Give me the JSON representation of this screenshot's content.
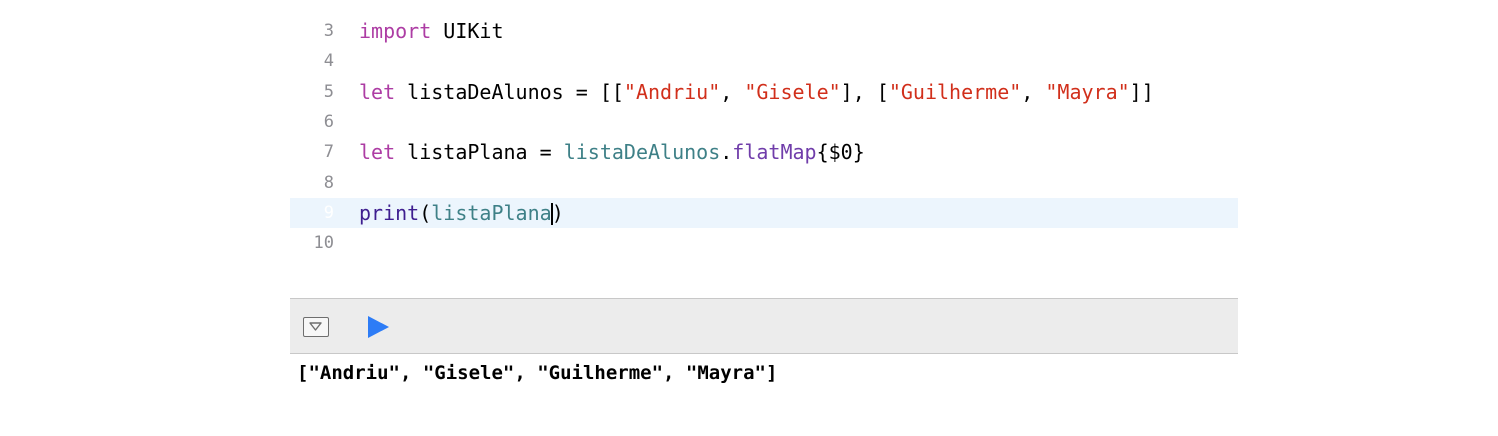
{
  "editor": {
    "lines": [
      {
        "number": "3",
        "tokens": [
          {
            "t": "import",
            "c": "kw"
          },
          {
            "t": " UIKit",
            "c": "plain"
          }
        ]
      },
      {
        "number": "4",
        "tokens": []
      },
      {
        "number": "5",
        "tokens": [
          {
            "t": "let",
            "c": "kw"
          },
          {
            "t": " listaDeAlunos = [[",
            "c": "plain"
          },
          {
            "t": "\"Andriu\"",
            "c": "str"
          },
          {
            "t": ", ",
            "c": "plain"
          },
          {
            "t": "\"Gisele\"",
            "c": "str"
          },
          {
            "t": "], [",
            "c": "plain"
          },
          {
            "t": "\"Guilherme\"",
            "c": "str"
          },
          {
            "t": ", ",
            "c": "plain"
          },
          {
            "t": "\"Mayra\"",
            "c": "str"
          },
          {
            "t": "]]",
            "c": "plain"
          }
        ]
      },
      {
        "number": "6",
        "tokens": []
      },
      {
        "number": "7",
        "tokens": [
          {
            "t": "let",
            "c": "kw"
          },
          {
            "t": " listaPlana = ",
            "c": "plain"
          },
          {
            "t": "listaDeAlunos",
            "c": "ident"
          },
          {
            "t": ".",
            "c": "plain"
          },
          {
            "t": "flatMap",
            "c": "method"
          },
          {
            "t": "{$0}",
            "c": "plain"
          }
        ]
      },
      {
        "number": "8",
        "tokens": []
      },
      {
        "number": "9",
        "current": true,
        "tokens": [
          {
            "t": "print",
            "c": "fn"
          },
          {
            "t": "(",
            "c": "plain"
          },
          {
            "t": "listaPlana",
            "c": "ident"
          },
          {
            "t": "|",
            "c": "caret"
          },
          {
            "t": ")",
            "c": "plain"
          }
        ]
      },
      {
        "number": "10",
        "tokens": []
      }
    ]
  },
  "toolbar": {
    "debug_toggle_icon": "triangle-down-icon",
    "run_icon": "play-icon",
    "run_color": "#2d7cf6"
  },
  "console": {
    "output": "[\"Andriu\", \"Gisele\", \"Guilherme\", \"Mayra\"]"
  }
}
